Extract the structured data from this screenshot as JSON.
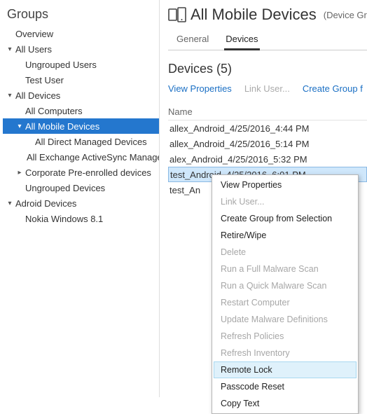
{
  "sidebar": {
    "title": "Groups",
    "nodes": [
      {
        "label": "Overview",
        "level": 0,
        "arrow": ""
      },
      {
        "label": "All Users",
        "level": 0,
        "arrow": "▾"
      },
      {
        "label": "Ungrouped Users",
        "level": 1,
        "arrow": ""
      },
      {
        "label": "Test User",
        "level": 1,
        "arrow": ""
      },
      {
        "label": "All Devices",
        "level": 0,
        "arrow": "▾"
      },
      {
        "label": "All Computers",
        "level": 1,
        "arrow": ""
      },
      {
        "label": "All Mobile Devices",
        "level": 1,
        "arrow": "▾",
        "selected": true
      },
      {
        "label": "All Direct Managed Devices",
        "level": 2,
        "arrow": ""
      },
      {
        "label": "All Exchange ActiveSync Managed D",
        "level": 2,
        "arrow": ""
      },
      {
        "label": "Corporate Pre-enrolled devices",
        "level": 1,
        "arrow": "▸"
      },
      {
        "label": "Ungrouped Devices",
        "level": 1,
        "arrow": ""
      },
      {
        "label": "Adroid Devices",
        "level": 0,
        "arrow": "▾"
      },
      {
        "label": "Nokia Windows 8.1",
        "level": 1,
        "arrow": ""
      }
    ]
  },
  "header": {
    "title": "All Mobile Devices",
    "subtitle": "(Device Grou"
  },
  "tabs": [
    {
      "label": "General",
      "active": false
    },
    {
      "label": "Devices",
      "active": true
    }
  ],
  "section": {
    "title": "Devices (5)"
  },
  "actions": [
    {
      "label": "View Properties",
      "disabled": false
    },
    {
      "label": "Link User...",
      "disabled": true
    },
    {
      "label": "Create Group f",
      "disabled": false
    }
  ],
  "columns": {
    "name": "Name"
  },
  "rows": [
    {
      "label": "allex_Android_4/25/2016_4:44 PM",
      "selected": false
    },
    {
      "label": "allex_Android_4/25/2016_5:14 PM",
      "selected": false
    },
    {
      "label": "alex_Android_4/25/2016_5:32 PM",
      "selected": false
    },
    {
      "label": "test_Android_4/25/2016_6:01 PM",
      "selected": true
    },
    {
      "label": "test_An",
      "selected": false
    }
  ],
  "context_menu": [
    {
      "label": "View Properties",
      "disabled": false
    },
    {
      "label": "Link User...",
      "disabled": true
    },
    {
      "label": "Create Group from Selection",
      "disabled": false
    },
    {
      "label": "Retire/Wipe",
      "disabled": false
    },
    {
      "label": "Delete",
      "disabled": true
    },
    {
      "label": "Run a Full Malware Scan",
      "disabled": true
    },
    {
      "label": "Run a Quick Malware Scan",
      "disabled": true
    },
    {
      "label": "Restart Computer",
      "disabled": true
    },
    {
      "label": "Update Malware Definitions",
      "disabled": true
    },
    {
      "label": "Refresh Policies",
      "disabled": true
    },
    {
      "label": "Refresh Inventory",
      "disabled": true
    },
    {
      "label": "Remote Lock",
      "disabled": false,
      "highlight": true
    },
    {
      "label": "Passcode Reset",
      "disabled": false
    },
    {
      "label": "Copy Text",
      "disabled": false
    }
  ]
}
